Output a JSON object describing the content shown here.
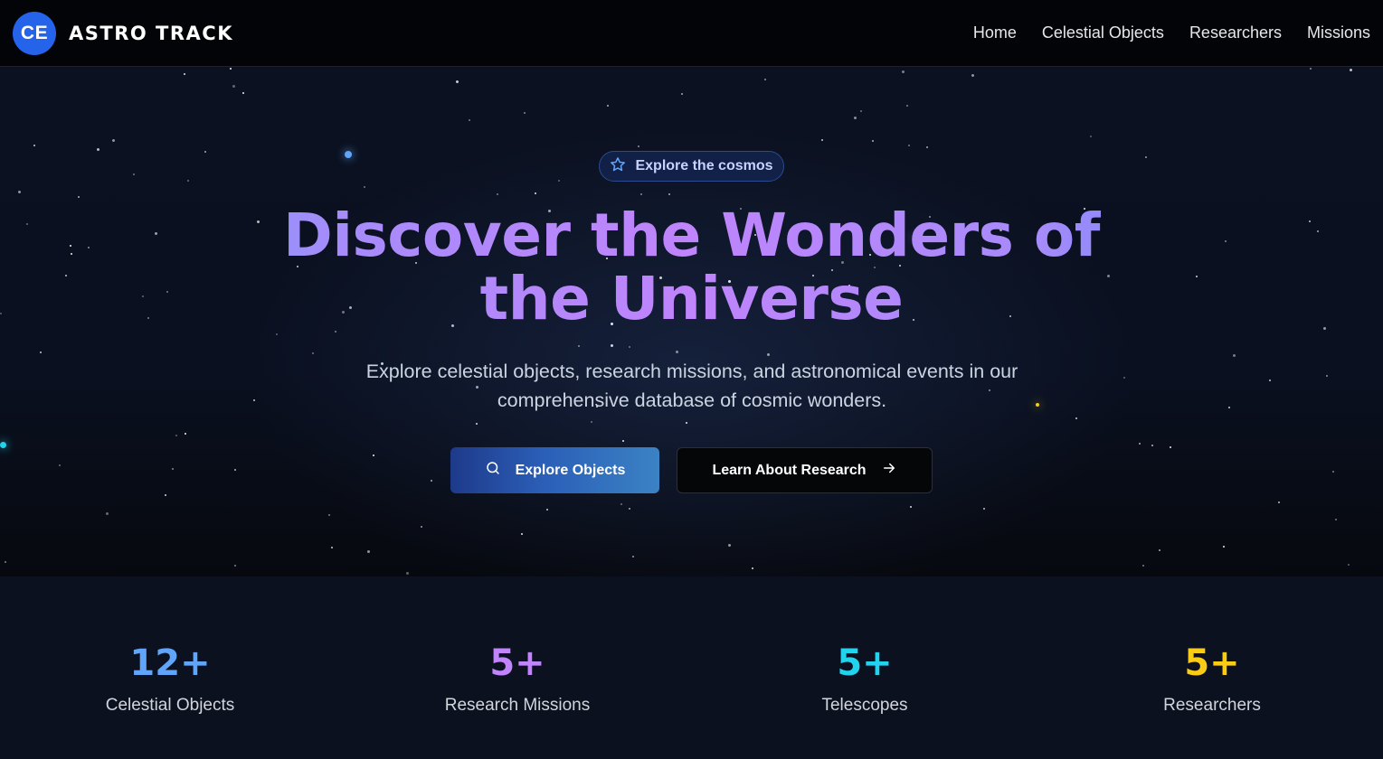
{
  "nav": {
    "logo_initials": "CE",
    "brand": "ASTRO TRACK",
    "links": [
      "Home",
      "Celestial Objects",
      "Researchers",
      "Missions"
    ]
  },
  "hero": {
    "badge": {
      "icon": "star-icon",
      "label": "Explore the cosmos"
    },
    "title_line1": "Discover the Wonders of",
    "title_line2": "the Universe",
    "subtitle": "Explore celestial objects, research missions, and astronomical events in our comprehensive database of cosmic wonders.",
    "primary_button": {
      "icon": "search-icon",
      "label": "Explore Objects"
    },
    "secondary_button": {
      "icon": "arrow-right-icon",
      "label": "Learn About Research"
    }
  },
  "stats": [
    {
      "value": "12+",
      "label": "Celestial Objects",
      "color": "#60a5fa"
    },
    {
      "value": "5+",
      "label": "Research Missions",
      "color": "#c084fc"
    },
    {
      "value": "5+",
      "label": "Telescopes",
      "color": "#22d3ee"
    },
    {
      "value": "5+",
      "label": "Researchers",
      "color": "#facc15"
    }
  ],
  "colors": {
    "accent": "#2563eb",
    "background": "#05070d",
    "stats_background": "#0c1120"
  }
}
